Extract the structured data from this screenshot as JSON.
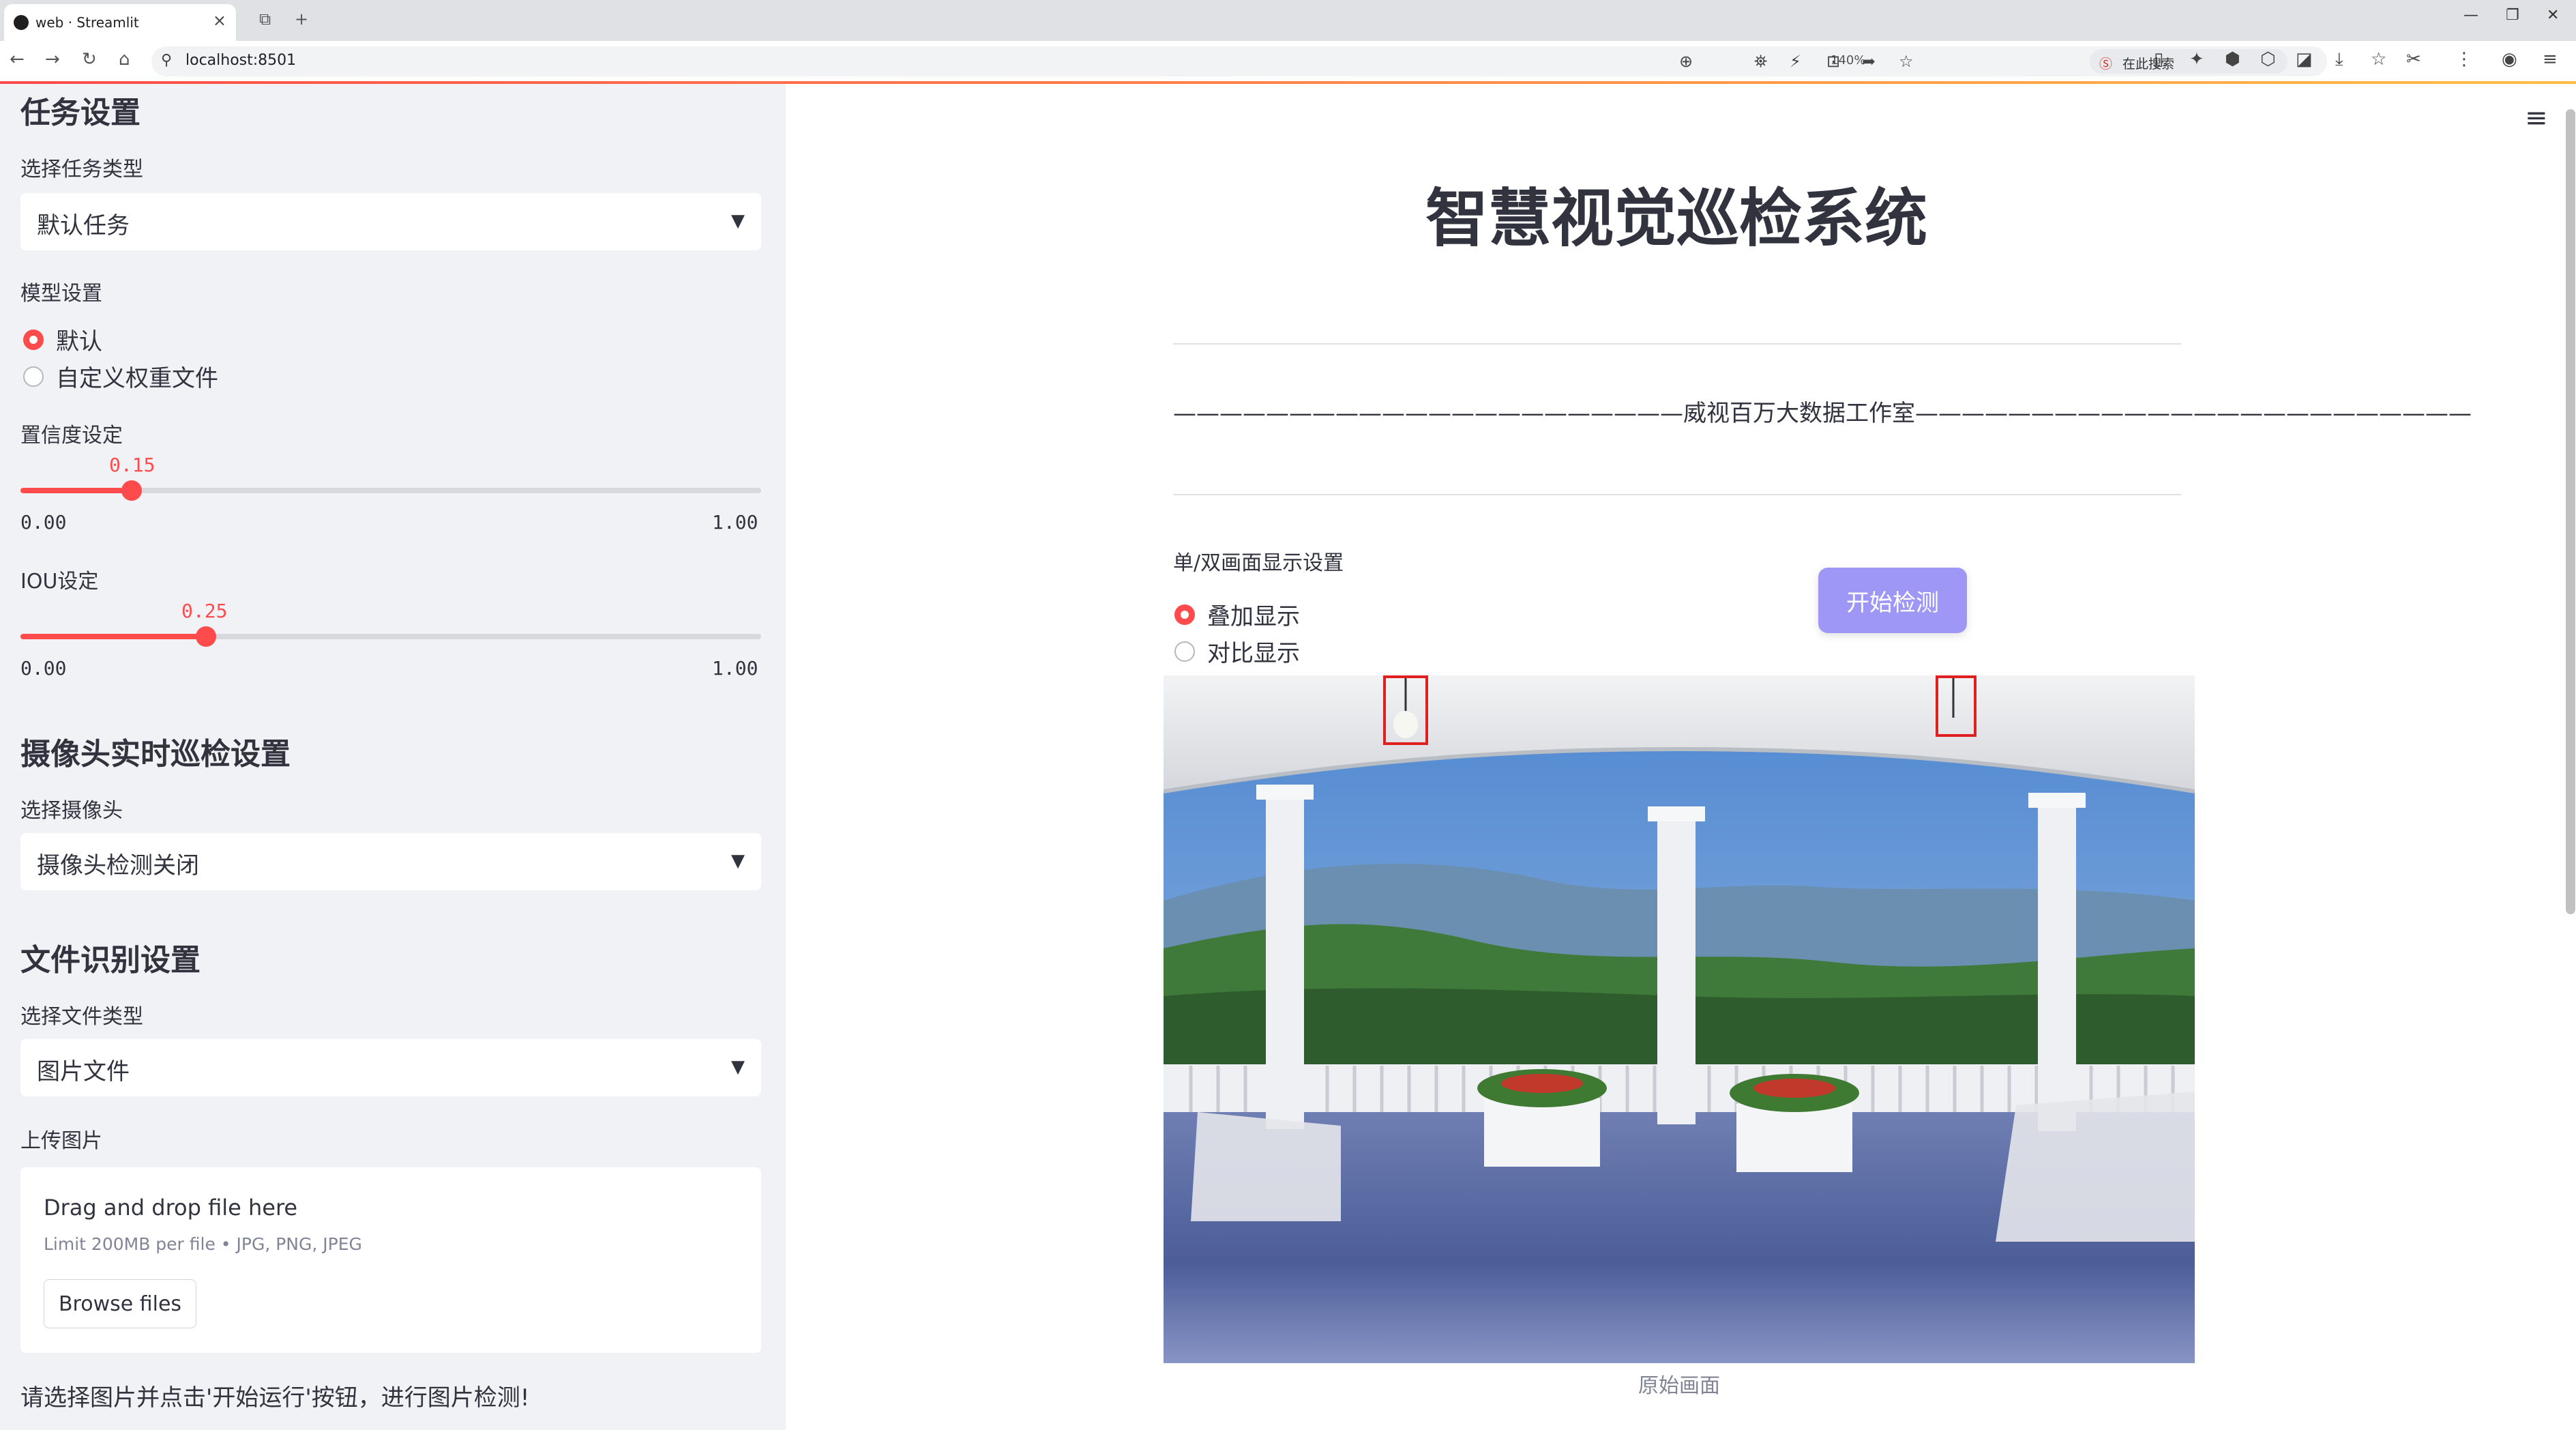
{
  "browser": {
    "tab_title": "web · Streamlit",
    "url": "localhost:8501",
    "zoom": "140%",
    "search_placeholder": "在此搜索"
  },
  "sidebar": {
    "task_heading": "任务设置",
    "task_type_label": "选择任务类型",
    "task_type_value": "默认任务",
    "model_label": "模型设置",
    "model_options": [
      {
        "label": "默认",
        "selected": true
      },
      {
        "label": "自定义权重文件",
        "selected": false
      }
    ],
    "confidence": {
      "label": "置信度设定",
      "value": "0.15",
      "min": "0.00",
      "max": "1.00",
      "fraction": 0.15
    },
    "iou": {
      "label": "IOU设定",
      "value": "0.25",
      "min": "0.00",
      "max": "1.00",
      "fraction": 0.25
    },
    "camera_heading": "摄像头实时巡检设置",
    "camera_label": "选择摄像头",
    "camera_value": "摄像头检测关闭",
    "file_heading": "文件识别设置",
    "file_type_label": "选择文件类型",
    "file_type_value": "图片文件",
    "upload_label": "上传图片",
    "uploader": {
      "title": "Drag and drop file here",
      "limit": "Limit 200MB per file • JPG, PNG, JPEG",
      "browse_label": "Browse files"
    },
    "hint": "请选择图片并点击'开始运行'按钮，进行图片检测!"
  },
  "main": {
    "title": "智慧视觉巡检系统",
    "subtitle": "——————————————————————威视百万大数据工作室————————————————————————",
    "display_label": "单/双画面显示设置",
    "display_options": [
      {
        "label": "叠加显示",
        "selected": true
      },
      {
        "label": "对比显示",
        "selected": false
      }
    ],
    "start_button": "开始检测",
    "image_caption": "原始画面"
  },
  "colors": {
    "accent": "#ff4b4b",
    "button": "#9f97f5",
    "sidebar_bg": "#f0f2f6",
    "detection_box": "#e02020"
  }
}
